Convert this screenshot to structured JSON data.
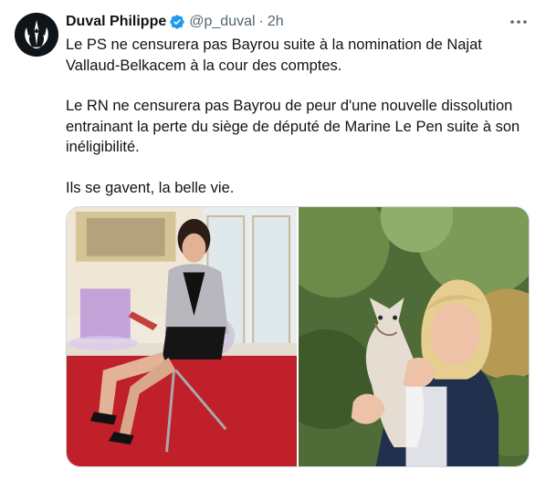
{
  "tweet": {
    "author": {
      "name": "Duval Philippe",
      "handle": "@p_duval",
      "verified": true,
      "avatar_icon": "rebel-alliance-logo-icon"
    },
    "time": "2h",
    "separator": "·",
    "paragraphs": [
      "Le PS ne censurera pas Bayrou suite à la nomination de Najat Vallaud-Belkacem à la cour des comptes.",
      "Le RN ne censurera pas Bayrou de peur d'une nouvelle dissolution entrainant la perte du siège de député de Marine Le Pen suite à son inéligibilité.",
      "Ils se gavent, la belle vie."
    ],
    "media": [
      {
        "icon": "photo-woman-seated-red-carpet"
      },
      {
        "icon": "photo-woman-holding-cat"
      }
    ]
  },
  "colors": {
    "text": "#0f1419",
    "secondary": "#536471",
    "verified_blue": "#1d9bf0",
    "border": "#cfd9de"
  }
}
